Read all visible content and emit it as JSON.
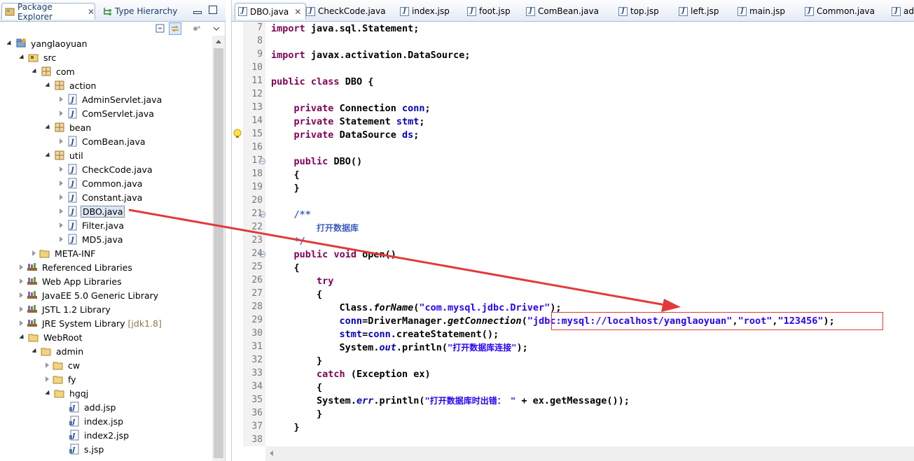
{
  "left_panel": {
    "tabs": [
      {
        "label": "Package Explorer",
        "icon": "package-explorer-icon"
      },
      {
        "label": "Type Hierarchy",
        "icon": "type-hierarchy-icon"
      }
    ],
    "tree": [
      {
        "label": "yanglaoyuan",
        "icon": "project-icon"
      },
      {
        "label": "src",
        "icon": "source-folder-icon"
      },
      {
        "label": "com",
        "icon": "package-icon"
      },
      {
        "label": "action",
        "icon": "package-icon"
      },
      {
        "label": "AdminServlet.java",
        "icon": "java-file-icon"
      },
      {
        "label": "ComServlet.java",
        "icon": "java-file-icon"
      },
      {
        "label": "bean",
        "icon": "package-icon"
      },
      {
        "label": "ComBean.java",
        "icon": "java-file-icon"
      },
      {
        "label": "util",
        "icon": "package-icon"
      },
      {
        "label": "CheckCode.java",
        "icon": "java-file-icon"
      },
      {
        "label": "Common.java",
        "icon": "java-file-icon"
      },
      {
        "label": "Constant.java",
        "icon": "java-file-icon"
      },
      {
        "label": "DBO.java",
        "icon": "java-file-icon"
      },
      {
        "label": "Filter.java",
        "icon": "java-file-icon"
      },
      {
        "label": "MD5.java",
        "icon": "java-file-icon"
      },
      {
        "label": "META-INF",
        "icon": "folder-icon"
      },
      {
        "label": "Referenced Libraries",
        "icon": "library-icon"
      },
      {
        "label": "Web App Libraries",
        "icon": "library-icon"
      },
      {
        "label": "JavaEE 5.0 Generic Library",
        "icon": "library-icon"
      },
      {
        "label": "JSTL 1.2 Library",
        "icon": "library-icon"
      },
      {
        "label": "JRE System Library",
        "suffix": "[jdk1.8]",
        "icon": "library-icon"
      },
      {
        "label": "WebRoot",
        "icon": "folder-icon"
      },
      {
        "label": "admin",
        "icon": "folder-icon"
      },
      {
        "label": "cw",
        "icon": "folder-icon"
      },
      {
        "label": "fy",
        "icon": "folder-icon"
      },
      {
        "label": "hgqj",
        "icon": "folder-icon"
      },
      {
        "label": "add.jsp",
        "icon": "jsp-file-icon"
      },
      {
        "label": "index.jsp",
        "icon": "jsp-file-icon"
      },
      {
        "label": "index2.jsp",
        "icon": "jsp-file-icon"
      },
      {
        "label": "s.jsp",
        "icon": "jsp-file-icon"
      }
    ]
  },
  "editor": {
    "tabs": [
      "DBO.java",
      "CheckCode.java",
      "index.jsp",
      "foot.jsp",
      "ComBean.java",
      "top.jsp",
      "left.jsp",
      "main.jsp",
      "Common.java",
      "ad"
    ],
    "lines": [
      {
        "n": "7",
        "text": "import java.sql.Statement;"
      },
      {
        "n": "8",
        "text": ""
      },
      {
        "n": "9",
        "text": "import javax.activation.DataSource;"
      },
      {
        "n": "10",
        "text": ""
      },
      {
        "n": "11",
        "text": "public class DBO {"
      },
      {
        "n": "12",
        "text": ""
      },
      {
        "n": "13",
        "text": "    private Connection conn;"
      },
      {
        "n": "14",
        "text": "    private Statement stmt;"
      },
      {
        "n": "15",
        "text": "    private DataSource ds;"
      },
      {
        "n": "16",
        "text": ""
      },
      {
        "n": "17",
        "text": "    public DBO()"
      },
      {
        "n": "18",
        "text": "    {"
      },
      {
        "n": "19",
        "text": "    }"
      },
      {
        "n": "20",
        "text": ""
      },
      {
        "n": "21",
        "text": "    /**"
      },
      {
        "n": "22",
        "text": "         打开数据库"
      },
      {
        "n": "23",
        "text": "    */"
      },
      {
        "n": "24",
        "text": "    public void open()"
      },
      {
        "n": "25",
        "text": "    {"
      },
      {
        "n": "26",
        "text": "        try"
      },
      {
        "n": "27",
        "text": "        {"
      },
      {
        "n": "28",
        "text": "            Class.forName(\"com.mysql.jdbc.Driver\");"
      },
      {
        "n": "29",
        "text": "            conn=DriverManager.getConnection(\"jdbc:mysql://localhost/yanglaoyuan\",\"root\",\"123456\");"
      },
      {
        "n": "30",
        "text": "            stmt=conn.createStatement();"
      },
      {
        "n": "31",
        "text": "            System.out.println(\"打开数据库连接\");"
      },
      {
        "n": "32",
        "text": "        }"
      },
      {
        "n": "33",
        "text": "        catch (Exception ex)"
      },
      {
        "n": "34",
        "text": "        {"
      },
      {
        "n": "35",
        "text": "        System.err.println(\"打开数据库时出错： \" + ex.getMessage());"
      },
      {
        "n": "36",
        "text": "        }"
      },
      {
        "n": "37",
        "text": "    }"
      },
      {
        "n": "38",
        "text": ""
      }
    ]
  },
  "colors": {
    "keyword": "#7f0055",
    "field": "#0000c0",
    "string": "#2a00ff",
    "comment": "#3f5fbf",
    "annotation": "#e23a3a"
  }
}
